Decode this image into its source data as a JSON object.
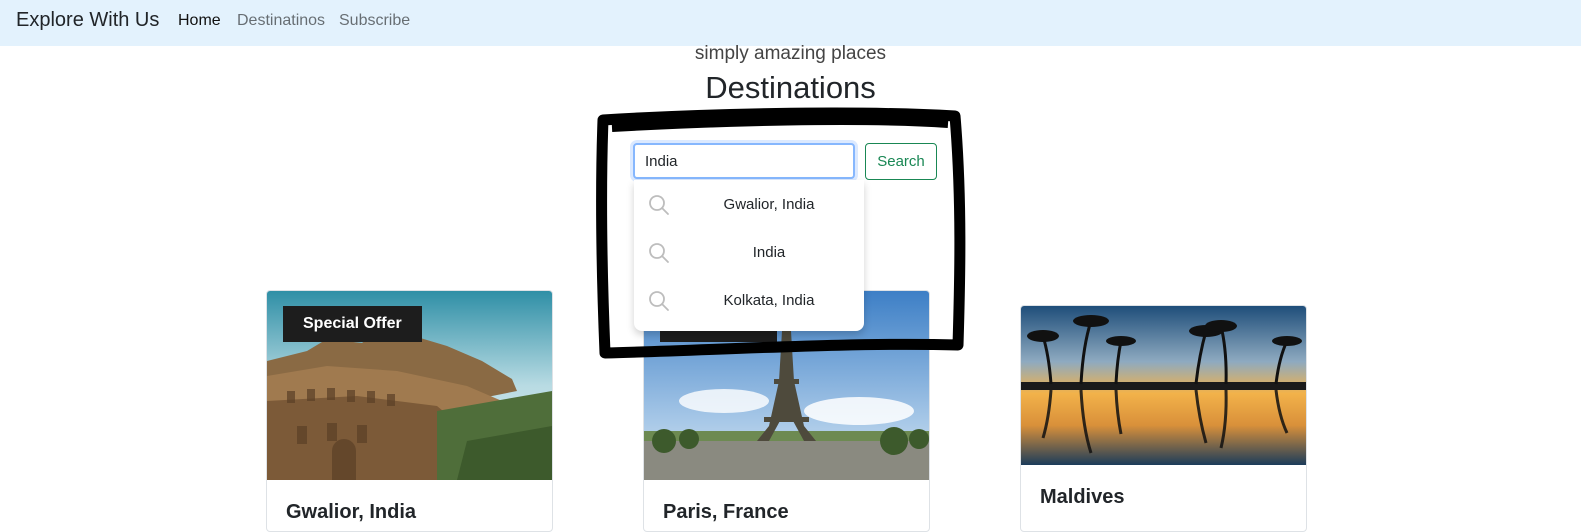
{
  "navbar": {
    "brand": "Explore With Us",
    "links": [
      "Home",
      "Destinatinos",
      "Subscribe"
    ],
    "background": "#e3f2fd"
  },
  "hero": {
    "tagline": "simply amazing places",
    "title": "Destinations"
  },
  "search": {
    "value": "India",
    "button_label": "Search",
    "suggestions": [
      "Gwalior, India",
      "India",
      "Kolkata, India"
    ],
    "accent": "#198754"
  },
  "cards": [
    {
      "title": "Gwalior, India",
      "badge": "Special Offer",
      "image": "fort-photo"
    },
    {
      "title": "Paris, France",
      "badge": "",
      "image": "eiffel-tower-photo"
    },
    {
      "title": "Maldives",
      "badge": "",
      "image": "palm-reflection-photo"
    }
  ]
}
